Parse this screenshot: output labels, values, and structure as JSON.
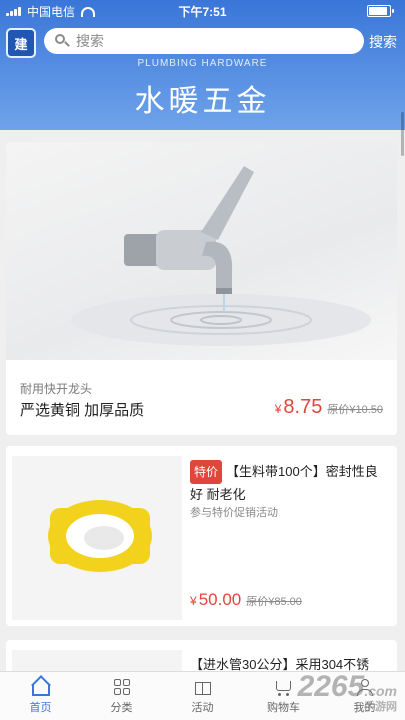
{
  "status_bar": {
    "carrier": "中国电信",
    "time": "下午7:51",
    "battery_level": 0.9
  },
  "header": {
    "logo_text": "建",
    "search_placeholder": "搜索",
    "search_button": "搜索",
    "banner_subtitle": "PLUMBING HARDWARE",
    "banner_title": "水暖五金"
  },
  "products": [
    {
      "subtitle": "耐用快开龙头",
      "name": "严选黄铜 加厚品质",
      "currency": "¥",
      "price": "8.75",
      "original_price": "原价¥10.50"
    },
    {
      "tag": "特价",
      "name": "【生料带100个】密封性良好 耐老化",
      "promo": "参与特价促销活动",
      "currency": "¥",
      "price": "50.00",
      "original_price": "原价¥85.00"
    },
    {
      "name": "【进水管30公分】采用304不锈"
    }
  ],
  "tabs": [
    {
      "label": "首页",
      "icon": "home-icon",
      "active": true
    },
    {
      "label": "分类",
      "icon": "grid-icon",
      "active": false
    },
    {
      "label": "活动",
      "icon": "gift-icon",
      "active": false
    },
    {
      "label": "购物车",
      "icon": "cart-icon",
      "active": false
    },
    {
      "label": "我的",
      "icon": "user-icon",
      "active": false
    }
  ],
  "watermark": {
    "text": "2265",
    "suffix": ".com",
    "site": "手游网"
  },
  "colors": {
    "brand_blue": "#3a76d8",
    "price_red": "#e0463c",
    "tape_yellow": "#f2d21c"
  }
}
